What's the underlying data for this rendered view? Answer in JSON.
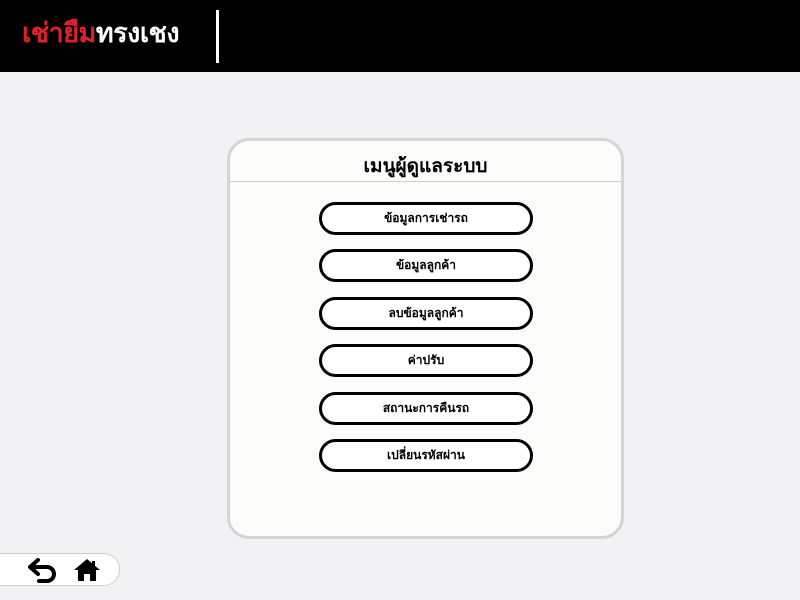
{
  "header": {
    "logo_part1": "เช่ายืม",
    "logo_part2": "ทรงเชง"
  },
  "panel": {
    "title": "เมนูผู้ดูแลระบบ",
    "menu": [
      {
        "label": "ข้อมูลการเช่ารถ"
      },
      {
        "label": "ข้อมูลลูกค้า"
      },
      {
        "label": "ลบข้อมูลลูกค้า"
      },
      {
        "label": "ค่าปรับ"
      },
      {
        "label": "สถานะการคืนรถ"
      },
      {
        "label": "เปลี่ยนรหัสผ่าน"
      }
    ]
  },
  "nav": {
    "back_icon": "back-arrow-icon",
    "home_icon": "home-icon"
  },
  "colors": {
    "header_bg": "#000000",
    "logo_red": "#e0202a",
    "page_bg": "#f2f2f4"
  }
}
